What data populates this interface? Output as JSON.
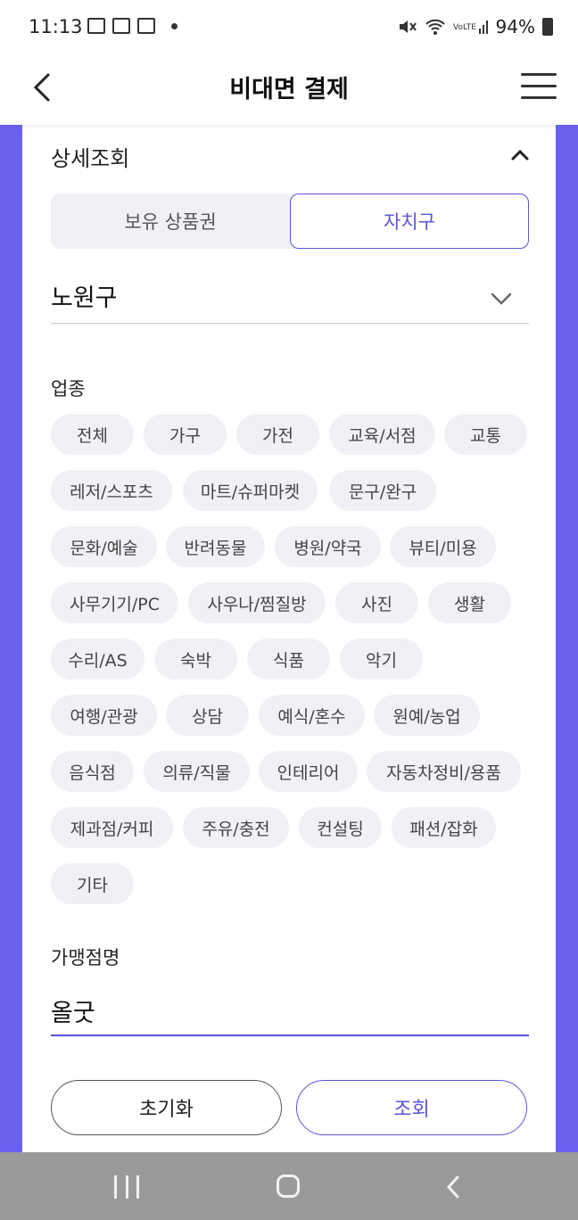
{
  "status": {
    "time": "11:13",
    "battery": "94%"
  },
  "header": {
    "title": "비대면 결제"
  },
  "detail": {
    "title": "상세조회",
    "toggle": {
      "option_left": "보유 상품권",
      "option_right": "자치구"
    },
    "district": "노원구",
    "category_label": "업종",
    "categories": [
      "전체",
      "가구",
      "가전",
      "교육/서점",
      "교통",
      "레저/스포츠",
      "마트/슈퍼마켓",
      "문구/완구",
      "문화/예술",
      "반려동물",
      "병원/약국",
      "뷰티/미용",
      "사무기기/PC",
      "사우나/찜질방",
      "사진",
      "생활",
      "수리/AS",
      "숙박",
      "식품",
      "악기",
      "여행/관광",
      "상담",
      "예식/혼수",
      "원예/농업",
      "음식점",
      "의류/직물",
      "인테리어",
      "자동차정비/용품",
      "제과점/커피",
      "주유/충전",
      "컨설팅",
      "패션/잡화",
      "기타"
    ],
    "store_label": "가맹점명",
    "store_value": "올굿",
    "reset_label": "초기화",
    "search_label": "조회"
  },
  "colors": {
    "accent": "#5b55d9",
    "frame": "#6a62ee"
  }
}
